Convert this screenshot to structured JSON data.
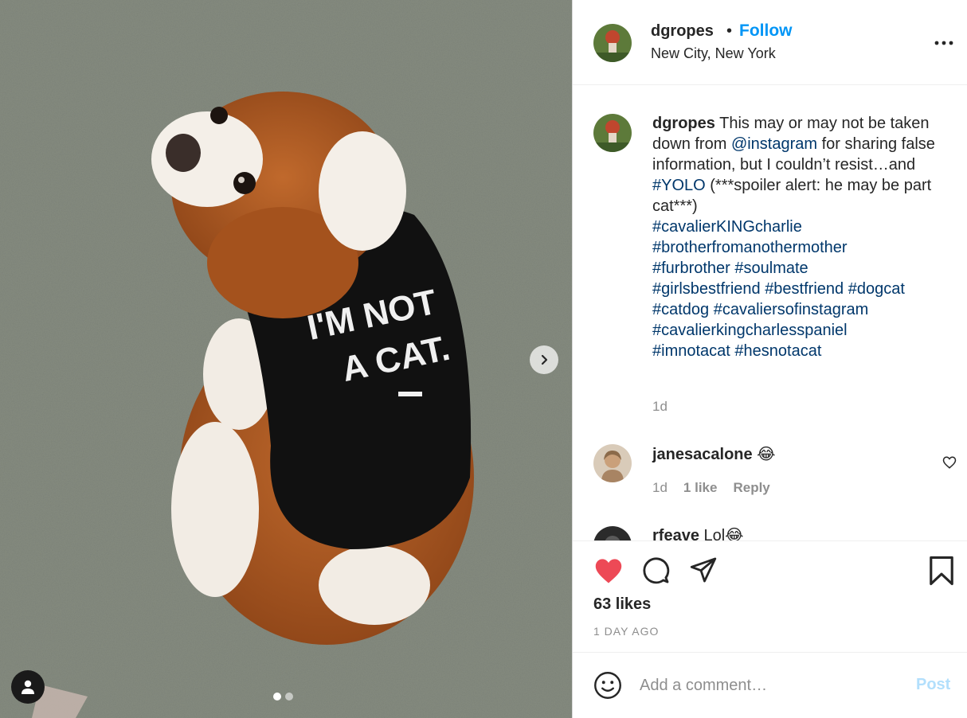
{
  "post": {
    "image_shirt_text": "I'M NOT A CAT.",
    "carousel_dots": 2,
    "active_dot": 0
  },
  "header": {
    "username": "dgropes",
    "separator": "•",
    "follow_label": "Follow",
    "location": "New City, New York"
  },
  "caption": {
    "username": "dgropes",
    "text_1": " This may or may not be taken down from ",
    "mention": "@instagram",
    "text_2": " for sharing false information, but I couldn’t resist…and ",
    "tag_yolo": "#YOLO",
    "text_3": " (***spoiler alert: he may be part cat***)",
    "hashtags": [
      "#cavalierKINGcharlie",
      "#brotherfromanothermother",
      "#furbrother",
      "#soulmate",
      "#girlsbestfriend",
      "#bestfriend",
      "#dogcat",
      "#catdog",
      "#cavaliersofinstagram",
      "#cavalierkingcharlesspaniel",
      "#imnotacat",
      "#hesnotacat"
    ],
    "time": "1d"
  },
  "comments": [
    {
      "username": "janesacalone",
      "text": " 😂",
      "time": "1d",
      "likes": "1 like",
      "reply": "Reply"
    },
    {
      "username": "rfeave",
      "text": " Lol😂"
    }
  ],
  "actions": {
    "likes": "63 likes",
    "time_ago": "1 DAY AGO"
  },
  "add_comment": {
    "placeholder": "Add a comment…",
    "post_label": "Post"
  },
  "colors": {
    "accent": "#0095f6",
    "heart": "#ed4956",
    "hashtag": "#00376b",
    "muted": "#8e8e8e",
    "post_disabled": "#b2dffc"
  },
  "icons": {
    "more": "more-horizontal-icon",
    "like": "heart-filled-icon",
    "comment": "comment-bubble-icon",
    "share": "paper-plane-icon",
    "save": "bookmark-icon",
    "emoji": "smiley-icon",
    "next": "chevron-right-icon",
    "tag": "user-tag-icon"
  }
}
